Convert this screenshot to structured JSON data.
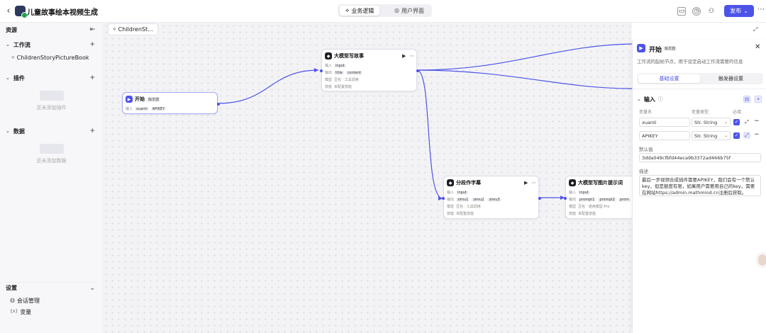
{
  "header": {
    "app_title": "儿童故事绘本视频生成",
    "tabs": [
      {
        "label": "业务逻辑",
        "active": true
      },
      {
        "label": "用户界面",
        "active": false
      }
    ],
    "publish_label": "发布",
    "icons": [
      "back-icon",
      "edit-icon",
      "clipboard-icon",
      "history-icon",
      "users-icon",
      "chevron-down-icon",
      "more-icon"
    ]
  },
  "sidebar": {
    "title": "资源",
    "sections": [
      {
        "label": "工作流",
        "items": [
          "ChildrenStoryPictureBook"
        ],
        "empty_text": ""
      },
      {
        "label": "插件",
        "items": [],
        "empty_text": "还未添加插件"
      },
      {
        "label": "数据",
        "items": [],
        "empty_text": "还未添加数据"
      }
    ],
    "settings": {
      "label": "设置",
      "items": [
        {
          "label": "会话管理",
          "icon": "chat-icon"
        },
        {
          "label": "变量",
          "icon": "variable-icon"
        }
      ]
    }
  },
  "canvas": {
    "breadcrumb": "ChildrenSt...",
    "nodes": {
      "start": {
        "title": "开始",
        "badge": "触发器",
        "input_label": "输入",
        "inputs": [
          "xuanti",
          "APIKEY"
        ]
      },
      "story": {
        "title": "大模型写故事",
        "input_label": "输入",
        "input": "input",
        "output_label": "输出",
        "outputs": [
          "title",
          "content"
        ],
        "model_label": "模型",
        "model": "豆包 · 工具调用",
        "skill_label": "技能",
        "skill": "未配置技能"
      },
      "split": {
        "title": "分段作字幕",
        "input_label": "输入",
        "input": "input",
        "output_label": "输出",
        "outputs": [
          "zimu1",
          "zimu2",
          "zimu3"
        ],
        "model_label": "模型",
        "model": "豆包 · 工具调用",
        "skill_label": "技能",
        "skill": "未配置技能"
      },
      "prompt": {
        "title": "大模型写图片提示词",
        "input_label": "输入",
        "input": "input",
        "output_label": "输出",
        "outputs": [
          "prompt1",
          "prompt2",
          "prom"
        ],
        "model_label": "模型",
        "model": "豆包 · 通用模型-Pro",
        "skill_label": "技能",
        "skill": "未配置技能"
      }
    }
  },
  "panel": {
    "title": "开始",
    "badge": "触发器",
    "description": "工作流的起始节点，用于设定启动工作流需要的信息",
    "tabs": [
      {
        "label": "基础设置",
        "active": true
      },
      {
        "label": "触发器设置",
        "active": false
      }
    ],
    "input_section": "输入",
    "columns": {
      "name": "变量名",
      "type": "变量类型",
      "required": "必填"
    },
    "variables": [
      {
        "name": "xuanti",
        "type": "Str. String",
        "required": true
      },
      {
        "name": "APIKEY",
        "type": "Str. String",
        "required": true
      }
    ],
    "default_label": "默认值",
    "default_value": "3dda049cfbfd44eca9b3372ad466b75f",
    "desc_label": "描述",
    "desc_value": "最后一步视频合成插件需要APIKEY，我们会有一个默认key，但是额度有限，如果用户需要用自己的key，需要在网站https://admin.mathmind.cn注册后获取。"
  }
}
